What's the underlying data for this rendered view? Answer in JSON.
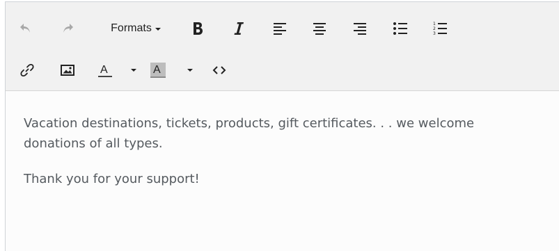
{
  "toolbar": {
    "formats_label": "Formats",
    "row1": [
      {
        "name": "undo-icon",
        "disabled": true
      },
      {
        "name": "redo-icon",
        "disabled": true
      },
      {
        "name": "bold-icon"
      },
      {
        "name": "italic-icon"
      },
      {
        "name": "align-left-icon"
      },
      {
        "name": "align-center-icon"
      },
      {
        "name": "align-right-icon"
      },
      {
        "name": "bullet-list-icon"
      },
      {
        "name": "numbered-list-icon"
      }
    ],
    "row2": [
      {
        "name": "link-icon"
      },
      {
        "name": "image-icon"
      },
      {
        "name": "text-color-icon",
        "label": "A"
      },
      {
        "name": "chevron-down-icon"
      },
      {
        "name": "background-color-icon",
        "label": "A"
      },
      {
        "name": "chevron-down-icon"
      },
      {
        "name": "source-code-icon"
      }
    ],
    "colors": {
      "toolbar_bg": "#f1f1f1",
      "icon": "#222222",
      "icon_disabled": "#a8a8a8",
      "highlight_swatch": "#bdbdbd"
    }
  },
  "content": {
    "paragraph1": "Vacation destinations, tickets, products, gift certificates. . . we welcome donations of all types.",
    "paragraph2": "Thank you for your support!",
    "text_color": "#555a5f"
  }
}
